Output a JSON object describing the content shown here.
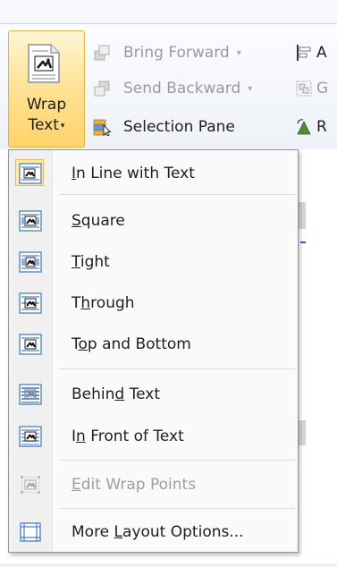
{
  "ribbon": {
    "wrap_text": {
      "line1": "Wrap",
      "line2": "Text",
      "caret": "▾",
      "icon": "wrap-text-icon"
    },
    "bring_forward": {
      "label": "Bring Forward",
      "caret": "▾",
      "icon": "bring-forward-icon"
    },
    "send_backward": {
      "label": "Send Backward",
      "caret": "▾",
      "icon": "send-backward-icon"
    },
    "selection_pane": {
      "label": "Selection Pane",
      "icon": "selection-pane-icon"
    },
    "align": {
      "label": "A",
      "icon": "align-icon"
    },
    "group": {
      "label": "G",
      "icon": "group-icon"
    },
    "rotate": {
      "label": "R",
      "icon": "rotate-icon"
    }
  },
  "menu": {
    "items": [
      {
        "label": "In Line with Text",
        "access_key": "I",
        "icon": "in-line-with-text-icon",
        "selected": true
      },
      {
        "label": "Square",
        "access_key": "S",
        "icon": "square-wrap-icon"
      },
      {
        "label": "Tight",
        "access_key": "T",
        "icon": "tight-wrap-icon"
      },
      {
        "label": "Through",
        "access_key": "h",
        "icon": "through-wrap-icon"
      },
      {
        "label": "Top and Bottom",
        "access_key": "o",
        "icon": "top-and-bottom-icon"
      },
      {
        "label": "Behind Text",
        "access_key": "d",
        "icon": "behind-text-icon"
      },
      {
        "label": "In Front of Text",
        "access_key": "n",
        "icon": "in-front-of-text-icon"
      },
      {
        "label": "Edit Wrap Points",
        "access_key": "E",
        "icon": "edit-wrap-points-icon",
        "disabled": true
      },
      {
        "label": "More Layout Options...",
        "access_key": "L",
        "icon": "more-layout-options-icon"
      }
    ]
  },
  "colors": {
    "selected_button": "#ffd36a",
    "selected_border": "#e3b440",
    "icon_blue": "#4a7fc0",
    "disabled_text": "#9e9e9e"
  }
}
